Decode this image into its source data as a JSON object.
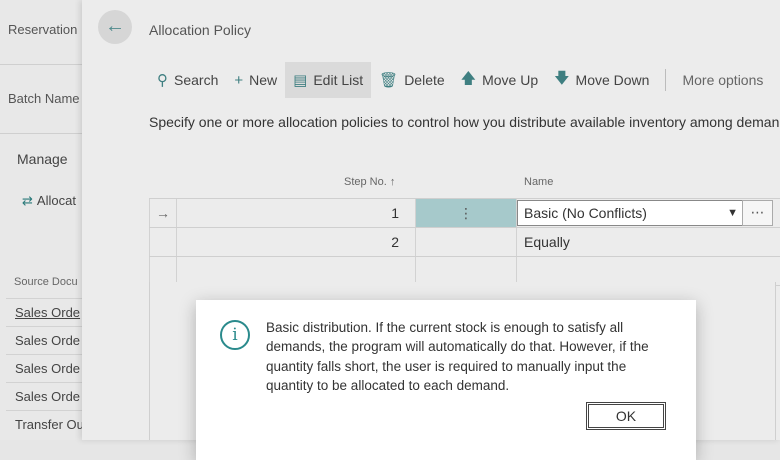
{
  "background": {
    "labels": [
      "Reservation",
      "Batch Name"
    ],
    "manage": "Manage",
    "action": "Allocat",
    "source_header": "Source Docu",
    "rows": [
      "Sales Orde",
      "Sales Orde",
      "Sales Orde",
      "Sales Orde",
      "Transfer Ou"
    ]
  },
  "panel": {
    "title": "Allocation Policy",
    "toolbar": {
      "search": "Search",
      "new": "New",
      "edit_list": "Edit List",
      "delete": "Delete",
      "move_up": "Move Up",
      "move_down": "Move Down",
      "more": "More options"
    },
    "description": "Specify one or more allocation policies to control how you distribute available inventory among deman",
    "grid": {
      "columns": {
        "step": "Step No. ↑",
        "name": "Name"
      },
      "rows": [
        {
          "step": "1",
          "name": "Basic (No Conflicts)",
          "selected": true
        },
        {
          "step": "2",
          "name": "Equally"
        },
        {
          "step": "",
          "name": ""
        }
      ],
      "select_marker": "→",
      "dots": "⋮",
      "more": "⋯"
    }
  },
  "dialog": {
    "message": "Basic distribution. If the current stock is enough to satisfy all demands, the program will automatically do that. However, if the quantity falls short, the user is required to manually input the quantity to be allocated to each demand.",
    "ok_label": "OK"
  },
  "colors": {
    "accent": "#2a8a8c",
    "highlight": "#a6c9cb"
  }
}
